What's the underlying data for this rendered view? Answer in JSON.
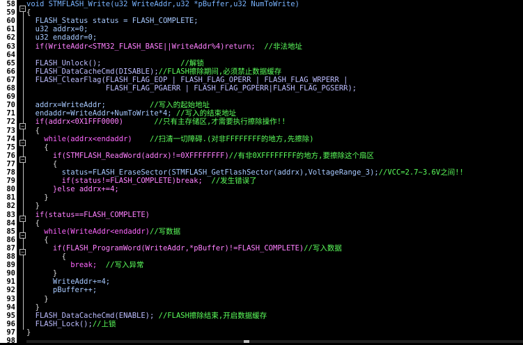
{
  "editor": {
    "lines": [
      {
        "n": "58",
        "t": "void STMFLASH_Write(u32 WriteAddr,u32 *pBuffer,u32 NumToWrite)",
        "c": "#7ab4ff"
      },
      {
        "n": "59",
        "t": "{",
        "c": "#dcdcdc"
      },
      {
        "n": "60",
        "t": "  FLASH_Status status = FLASH_COMPLETE;",
        "c": "#a7c9ff"
      },
      {
        "n": "61",
        "t": "  u32 addrx=0;",
        "c": "#a7c9ff"
      },
      {
        "n": "62",
        "t": "  u32 endaddr=0;",
        "c": "#a7c9ff"
      },
      {
        "n": "63",
        "t": "  if(WriteAddr<STM32_FLASH_BASE||WriteAddr%4)return;  //非法地址",
        "c": "#ff80ff"
      },
      {
        "n": "64",
        "t": "",
        "c": "#dcdcdc"
      },
      {
        "n": "65",
        "t": "  FLASH_Unlock();                  //解锁",
        "c": "#bdbdff"
      },
      {
        "n": "66",
        "t": "  FLASH_DataCacheCmd(DISABLE);//FLASH擦除期间,必须禁止数据缓存",
        "c": "#bdbdff"
      },
      {
        "n": "67",
        "t": "  FLASH_ClearFlag(FLASH_FLAG_EOP | FLASH_FLAG_OPERR | FLASH_FLAG_WRPERR |",
        "c": "#bdbdff"
      },
      {
        "n": "68",
        "t": "                  FLASH_FLAG_PGAERR | FLASH_FLAG_PGPERR|FLASH_FLAG_PGSERR);",
        "c": "#bdbdff"
      },
      {
        "n": "69",
        "t": "",
        "c": "#dcdcdc"
      },
      {
        "n": "70",
        "t": "  addrx=WriteAddr;          //写入的起始地址",
        "c": "#a7c9ff"
      },
      {
        "n": "71",
        "t": "  endaddr=WriteAddr+NumToWrite*4; //写入的结束地址",
        "c": "#a7c9ff"
      },
      {
        "n": "72",
        "t": "  if(addrx<0X1FFF0000)       //只有主存储区,才需要执行擦除操作!!",
        "c": "#ff80ff"
      },
      {
        "n": "73",
        "t": "  {",
        "c": "#dcdcdc"
      },
      {
        "n": "74",
        "t": "    while(addrx<endaddr)    //扫清一切障碍.(对非FFFFFFFF的地方,先擦除)",
        "c": "#ff66ff"
      },
      {
        "n": "75",
        "t": "    {",
        "c": "#dcdcdc"
      },
      {
        "n": "76",
        "t": "      if(STMFLASH_ReadWord(addrx)!=0XFFFFFFFF)//有非0XFFFFFFFF的地方,要擦除这个扇区",
        "c": "#ff80ff"
      },
      {
        "n": "77",
        "t": "      {",
        "c": "#dcdcdc"
      },
      {
        "n": "78",
        "t": "        status=FLASH_EraseSector(STMFLASH_GetFlashSector(addrx),VoltageRange_3);//VCC=2.7~3.6V之间!!",
        "c": "#a7c9ff"
      },
      {
        "n": "79",
        "t": "        if(status!=FLASH_COMPLETE)break;  //发生错误了",
        "c": "#ff80ff"
      },
      {
        "n": "80",
        "t": "      }else addrx+=4;",
        "c": "#ff80ff"
      },
      {
        "n": "81",
        "t": "    }",
        "c": "#dcdcdc"
      },
      {
        "n": "82",
        "t": "  }",
        "c": "#dcdcdc"
      },
      {
        "n": "83",
        "t": "  if(status==FLASH_COMPLETE)",
        "c": "#ff80ff"
      },
      {
        "n": "84",
        "t": "  {",
        "c": "#dcdcdc"
      },
      {
        "n": "85",
        "t": "    while(WriteAddr<endaddr)//写数据",
        "c": "#ff66ff"
      },
      {
        "n": "86",
        "t": "    {",
        "c": "#dcdcdc"
      },
      {
        "n": "87",
        "t": "      if(FLASH_ProgramWord(WriteAddr,*pBuffer)!=FLASH_COMPLETE)//写入数据",
        "c": "#ff80ff"
      },
      {
        "n": "88",
        "t": "        {",
        "c": "#dcdcdc"
      },
      {
        "n": "89",
        "t": "          break;  //写入异常",
        "c": "#ff66ff"
      },
      {
        "n": "90",
        "t": "      }",
        "c": "#dcdcdc"
      },
      {
        "n": "91",
        "t": "      WriteAddr+=4;",
        "c": "#a7c9ff"
      },
      {
        "n": "92",
        "t": "      pBuffer++;",
        "c": "#a7c9ff"
      },
      {
        "n": "93",
        "t": "    }",
        "c": "#dcdcdc"
      },
      {
        "n": "94",
        "t": "  }",
        "c": "#dcdcdc"
      },
      {
        "n": "95",
        "t": "  FLASH_DataCacheCmd(ENABLE); //FLASH擦除结束,开启数据缓存",
        "c": "#bdbdff"
      },
      {
        "n": "96",
        "t": "  FLASH_Lock();//上锁",
        "c": "#bdbdff"
      },
      {
        "n": "97",
        "t": "}",
        "c": "#dcdcdc"
      },
      {
        "n": "98",
        "t": "",
        "c": "#dcdcdc"
      }
    ]
  },
  "colors": {
    "background": "#000000",
    "gutter": "#ffffff",
    "comment": "#5cff5c"
  }
}
